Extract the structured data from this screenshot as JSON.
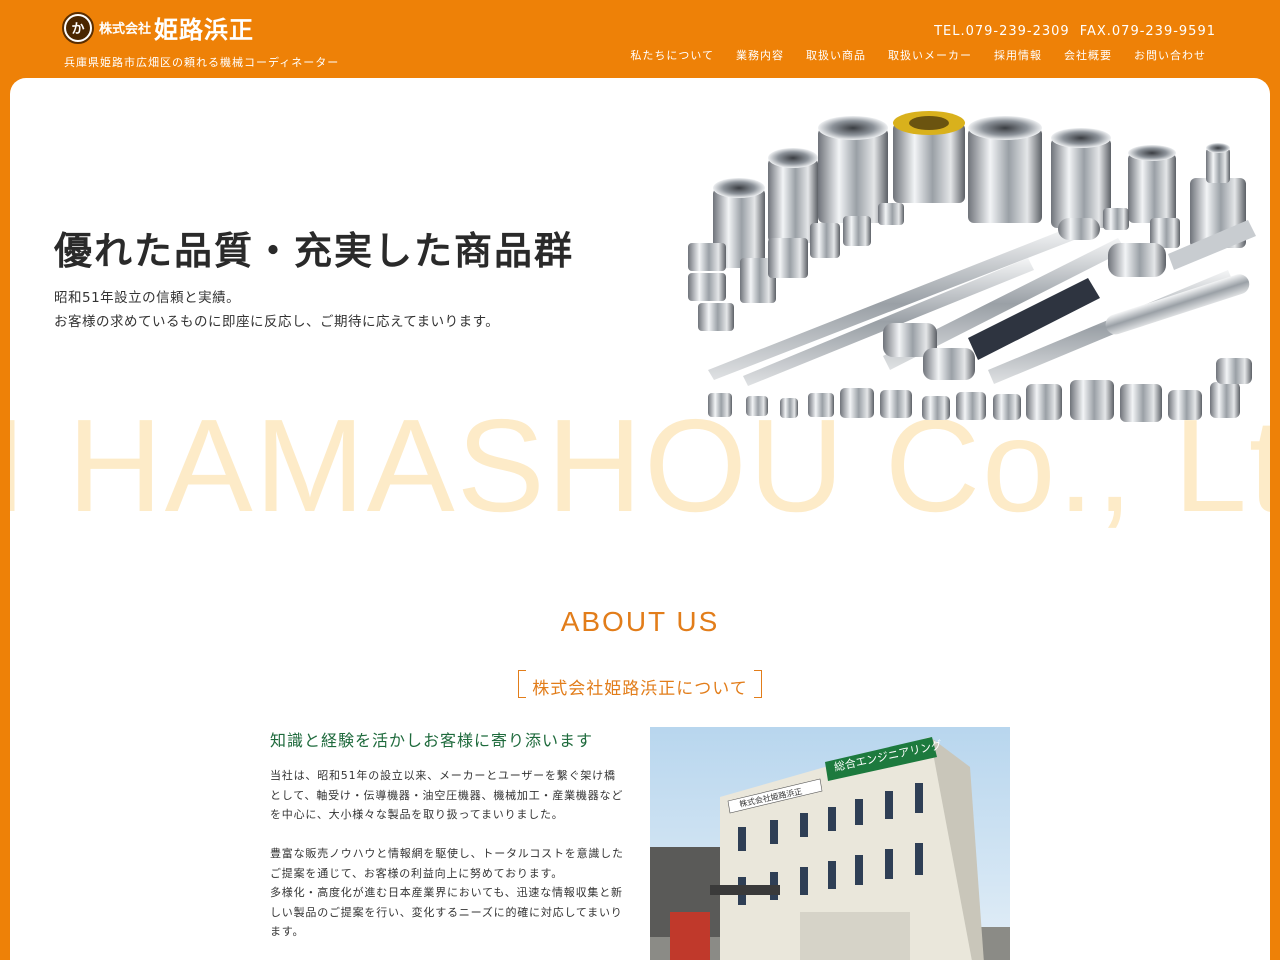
{
  "header": {
    "logo_mark": "か",
    "logo_kaisha": "株式会社",
    "logo_name": "姫路浜正",
    "tagline": "兵庫県姫路市広畑区の頼れる機械コーディネーター",
    "tel": "TEL.079-239-2309",
    "fax": "FAX.079-239-9591"
  },
  "nav": {
    "items": [
      {
        "label": "私たちについて"
      },
      {
        "label": "業務内容"
      },
      {
        "label": "取扱い商品"
      },
      {
        "label": "取扱いメーカー"
      },
      {
        "label": "採用情報"
      },
      {
        "label": "会社概要"
      },
      {
        "label": "お問い合わせ"
      }
    ]
  },
  "hero": {
    "title": "優れた品質・充実した商品群",
    "line1": "昭和51年設立の信頼と実績。",
    "line2": "お客様の求めているものに即座に反応し、ご期待に応えてまいります。",
    "watermark": "I HAMASHOU Co., Lt"
  },
  "about": {
    "heading_en": "ABOUT US",
    "heading_jp": "株式会社姫路浜正について",
    "subheading": "知識と経験を活かしお客様に寄り添います",
    "para1": "当社は、昭和51年の設立以来、メーカーとユーザーを繋ぐ架け橋として、軸受け・伝導機器・油空圧機器、機械加工・産業機器などを中心に、大小様々な製品を取り扱ってまいりました。",
    "para2": "豊富な販売ノウハウと情報網を駆使し、トータルコストを意識したご提案を通じて、お客様の利益向上に努めております。",
    "para3": "多様化・高度化が進む日本産業界においても、迅速な情報収集と新しい製品のご提案を行い、変化するニーズに的確に対応してまいります。",
    "building_sign": "総合エンジニアリング",
    "building_name": "株式会社姫路浜正"
  },
  "colors": {
    "brand": "#EE8107",
    "accent_text": "#E27D1A",
    "subheading_green": "#1e6a3c",
    "watermark": "#FDEBC8"
  }
}
